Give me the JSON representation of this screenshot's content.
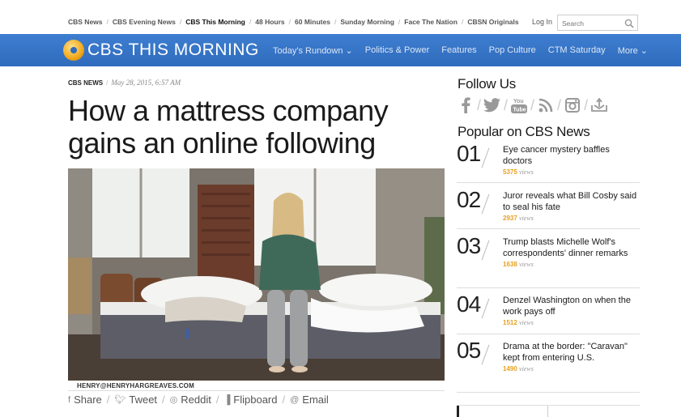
{
  "network_nav": {
    "items": [
      {
        "label": "CBS News",
        "active": false
      },
      {
        "label": "CBS Evening News",
        "active": false
      },
      {
        "label": "CBS This Morning",
        "active": true
      },
      {
        "label": "48 Hours",
        "active": false
      },
      {
        "label": "60 Minutes",
        "active": false
      },
      {
        "label": "Sunday Morning",
        "active": false
      },
      {
        "label": "Face The Nation",
        "active": false
      },
      {
        "label": "CBSN Originals",
        "active": false
      }
    ],
    "login": "Log In",
    "search_placeholder": "Search"
  },
  "show_bar": {
    "logo_text": "CBS THIS MORNING",
    "nav": [
      "Today's Rundown ⌄",
      "Politics & Power",
      "Features",
      "Pop Culture",
      "CTM Saturday",
      "More ⌄"
    ],
    "colors": {
      "bar": "#3371c4",
      "logo_eye": "#f0a81a"
    }
  },
  "article": {
    "source": "CBS NEWS",
    "date": "May 28, 2015, 6:57 AM",
    "headline": "How a mattress company gains an online following",
    "photo_credit": "HENRY@HENRYHARGREAVES.COM",
    "share": [
      {
        "icon": "facebook-icon",
        "label": "Share"
      },
      {
        "icon": "twitter-icon",
        "label": "Tweet"
      },
      {
        "icon": "reddit-icon",
        "label": "Reddit"
      },
      {
        "icon": "flipboard-icon",
        "label": "Flipboard"
      },
      {
        "icon": "email-icon",
        "label": "Email"
      }
    ]
  },
  "sidebar": {
    "follow_title": "Follow Us",
    "social": [
      "facebook-icon",
      "twitter-icon",
      "youtube-icon",
      "rss-icon",
      "instagram-icon",
      "download-icon"
    ],
    "popular_title": "Popular on CBS News",
    "popular": [
      {
        "num": "01",
        "title": "Eye cancer mystery baffles doctors",
        "views": "5375",
        "views_label": "views"
      },
      {
        "num": "02",
        "title": "Juror reveals what Bill Cosby said to seal his fate",
        "views": "2937",
        "views_label": "views"
      },
      {
        "num": "03",
        "title": "Trump blasts Michelle Wolf's correspondents' dinner remarks",
        "views": "1638",
        "views_label": "views"
      },
      {
        "num": "04",
        "title": "Denzel Washington on when the work pays off",
        "views": "1512",
        "views_label": "views"
      },
      {
        "num": "05",
        "title": "Drama at the border: \"Caravan\" kept from entering U.S.",
        "views": "1490",
        "views_label": "views"
      }
    ],
    "accent_color": "#e8a020"
  }
}
